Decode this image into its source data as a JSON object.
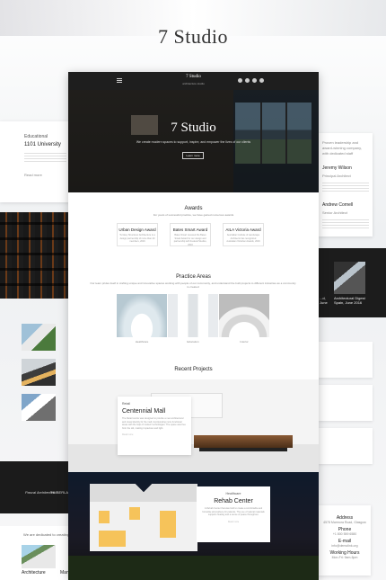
{
  "header": {
    "title": "7 Studio"
  },
  "site": {
    "brand": "7 Studio",
    "brand_sub": "architecture studio",
    "hero_title": "7 Studio",
    "hero_sub": "We create modern spaces to support, inspire, and empower the lives of our clients",
    "hero_button": "Learn more"
  },
  "awards": {
    "title": "Awards",
    "subtitle": "For years of successful practice, we have gained numerous awards",
    "items": [
      {
        "title": "Urban Design Award",
        "desc": "Turnkey Structures Architecture is a design partnership of more than 20 members, 2016"
      },
      {
        "title": "Bates Smart Award",
        "desc": "Bates Smart received the Bates Smart Award for our design and partnership with Federal Studios, 2016"
      },
      {
        "title": "AILA Victoria Award",
        "desc": "Australian Institute of Landscape Architects has recognized Australian Victorian Awards, 2016"
      }
    ]
  },
  "practice": {
    "title": "Practice Areas",
    "subtitle": "Our team prides itself in crafting unique and innovative spaces working with people of our community, and understand the built projects to different industries as a community is created",
    "items": [
      "Healthcare",
      "Education",
      "Interior"
    ]
  },
  "projects": {
    "title": "Recent Projects",
    "p1": {
      "category": "Retail",
      "name": "Centennial Mall",
      "desc": "The Retail centre was designed to provide a new architectural and visual identity for the mall, incorporating more functional areas with the help of modern technologies. The space was free from the old, making it spacious and light.",
      "more": "Read more"
    },
    "p2": {
      "category": "Healthcare",
      "name": "Rehab Center",
      "desc": "A Rehab Center that was built to create a comfortable and homelike atmosphere for patients. The use of natural materials supports healing and a sense of peace throughout.",
      "more": "Read more"
    }
  },
  "left": {
    "edu_label": "Educational",
    "edu_title": "1101 University",
    "edu_more": "Read more",
    "logos": [
      "Pascal Architectes",
      "TIMBERLAND"
    ],
    "bottom_text": "We are dedicated to creating spaces with...",
    "arch_label": "Architecture",
    "man_label": "Man"
  },
  "right": {
    "intro": "Proven leadership and award-winning company, with dedicated staff",
    "people": [
      {
        "name": "Jeremy Wilson",
        "role": "Principal Architect"
      },
      {
        "name": "Andrew Cornell",
        "role": "Senior Architect"
      }
    ],
    "gallery_captions": [
      "Architectural Digest Spain, June 2016",
      "...d, June"
    ],
    "contact": [
      {
        "title": "Address",
        "value": "4578 Marmora Road, Glasgow"
      },
      {
        "title": "Phone",
        "value": "+1 800 559 6580"
      },
      {
        "title": "E-mail",
        "value": "info@demolink.org"
      },
      {
        "title": "Working Hours",
        "value": "Mon-Fri: 9am-6pm"
      }
    ]
  },
  "colors": {
    "dark": "#1e1e1e",
    "accent": "#f6c35a"
  }
}
